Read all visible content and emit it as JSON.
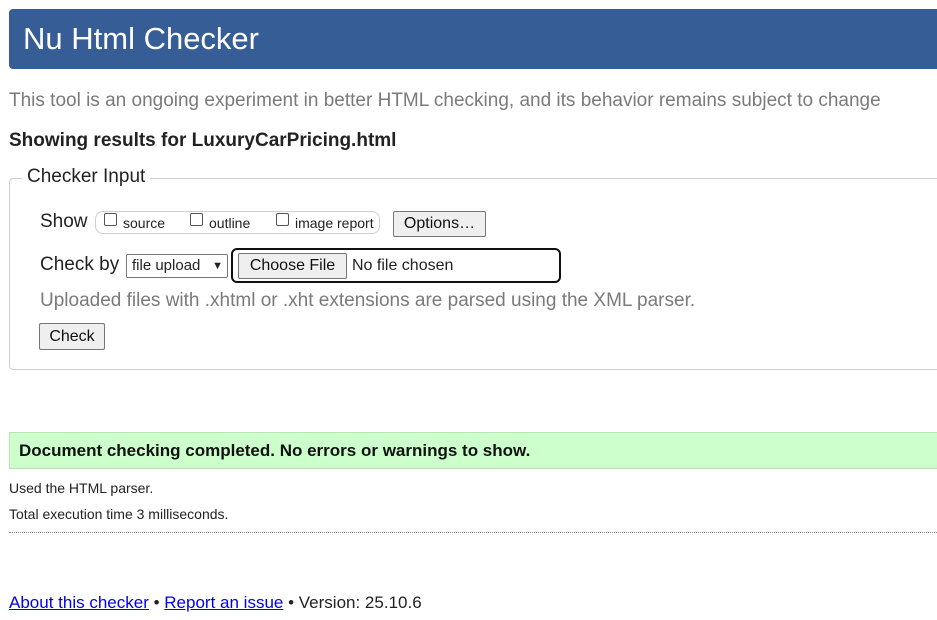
{
  "header": {
    "title": "Nu Html Checker",
    "background": "#365d95"
  },
  "tagline": "This tool is an ongoing experiment in better HTML checking, and its behavior remains subject to change",
  "results_heading": "Showing results for LuxuryCarPricing.html",
  "checker_input": {
    "legend": "Checker Input",
    "show_label": "Show",
    "checkboxes": [
      {
        "label": "source",
        "checked": false
      },
      {
        "label": "outline",
        "checked": false
      },
      {
        "label": "image report",
        "checked": false
      }
    ],
    "options_button": "Options…",
    "check_by_label": "Check by",
    "check_by_select": {
      "selected": "file upload"
    },
    "choose_file_button": "Choose File",
    "no_file_text": "No file chosen",
    "note": "Uploaded files with .xhtml or .xht extensions are parsed using the XML parser.",
    "check_button": "Check"
  },
  "success": {
    "message": "Document checking completed. No errors or warnings to show.",
    "background": "#ccffcc"
  },
  "details": {
    "parser": "Used the HTML parser.",
    "execution": "Total execution time 3 milliseconds."
  },
  "footer": {
    "about_link": "About this checker",
    "separator": "•",
    "report_link": "Report an issue",
    "version": "Version: 25.10.6"
  }
}
